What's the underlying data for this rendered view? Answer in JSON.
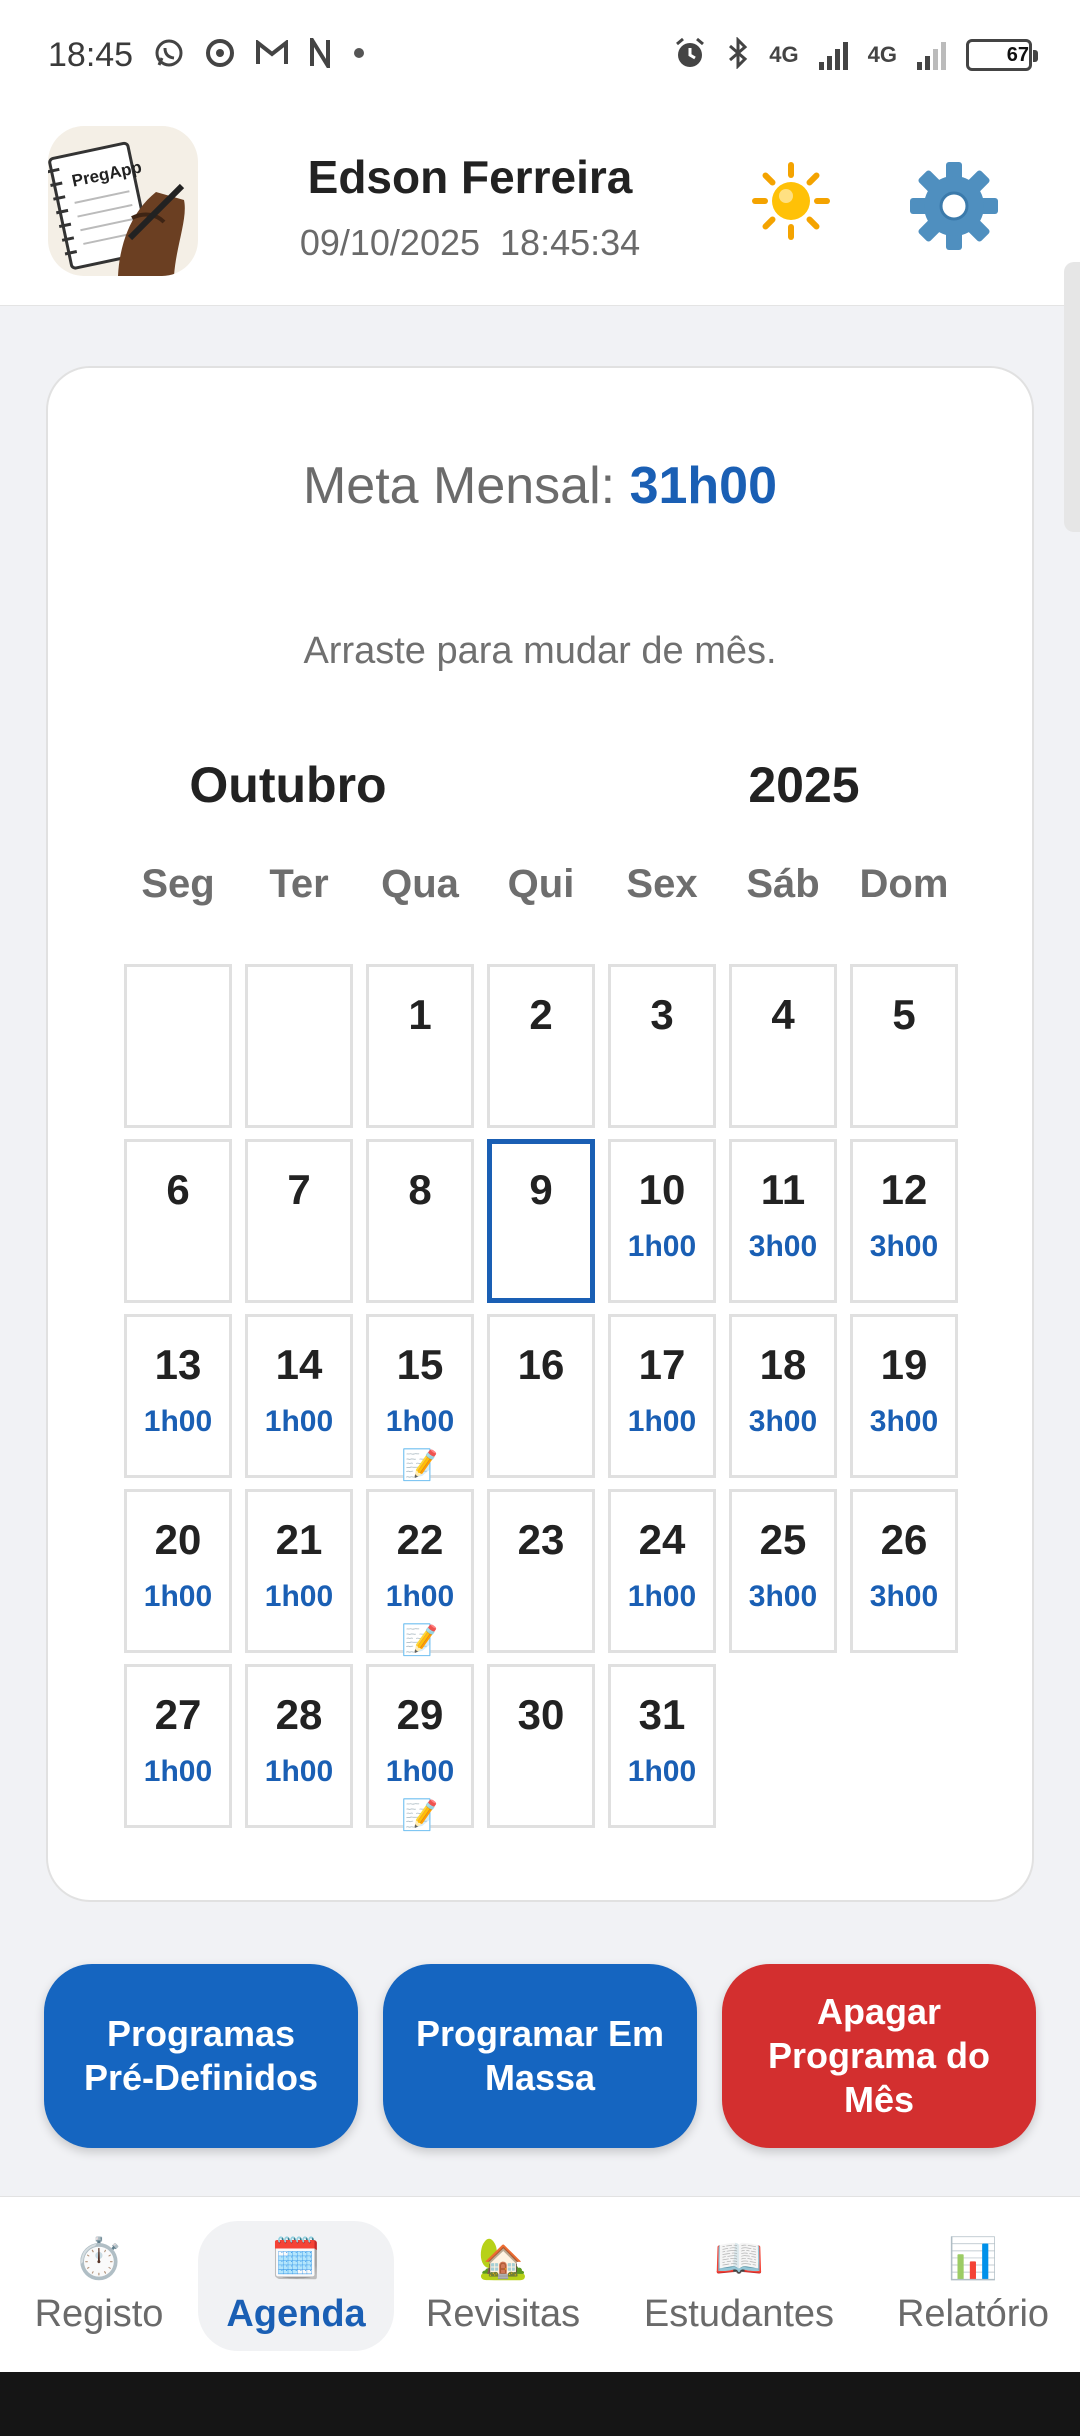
{
  "status_bar": {
    "time": "18:45",
    "battery": "67",
    "battery_level": 0.67,
    "network_1": "4G",
    "network_2": "4G",
    "notification_icons": [
      "whatsapp-icon",
      "chrome-icon",
      "gmail-icon",
      "n-app-icon",
      "dot-icon"
    ],
    "system_icons": [
      "alarm-icon",
      "bluetooth-icon",
      "signal-icon",
      "signal-icon",
      "battery-icon"
    ]
  },
  "header": {
    "logo_text": "PregApp",
    "user_name": "Edson Ferreira",
    "datetime": "09/10/2025  18:45:34",
    "theme_icon": "sun-icon",
    "settings_icon": "gear-icon"
  },
  "calendar": {
    "goal_label": "Meta Mensal:",
    "goal_value": "31h00",
    "hint": "Arraste para mudar de mês.",
    "month": "Outubro",
    "year": "2025",
    "weekdays": [
      "Seg",
      "Ter",
      "Qua",
      "Qui",
      "Sex",
      "Sáb",
      "Dom"
    ],
    "first_weekday_index": 2,
    "today": 9,
    "days": [
      {
        "d": "1",
        "h": "",
        "note": false
      },
      {
        "d": "2",
        "h": "",
        "note": false
      },
      {
        "d": "3",
        "h": "",
        "note": false
      },
      {
        "d": "4",
        "h": "",
        "note": false
      },
      {
        "d": "5",
        "h": "",
        "note": false
      },
      {
        "d": "6",
        "h": "",
        "note": false
      },
      {
        "d": "7",
        "h": "",
        "note": false
      },
      {
        "d": "8",
        "h": "",
        "note": false
      },
      {
        "d": "9",
        "h": "",
        "note": false
      },
      {
        "d": "10",
        "h": "1h00",
        "note": false
      },
      {
        "d": "11",
        "h": "3h00",
        "note": false
      },
      {
        "d": "12",
        "h": "3h00",
        "note": false
      },
      {
        "d": "13",
        "h": "1h00",
        "note": false
      },
      {
        "d": "14",
        "h": "1h00",
        "note": false
      },
      {
        "d": "15",
        "h": "1h00",
        "note": true
      },
      {
        "d": "16",
        "h": "",
        "note": false
      },
      {
        "d": "17",
        "h": "1h00",
        "note": false
      },
      {
        "d": "18",
        "h": "3h00",
        "note": false
      },
      {
        "d": "19",
        "h": "3h00",
        "note": false
      },
      {
        "d": "20",
        "h": "1h00",
        "note": false
      },
      {
        "d": "21",
        "h": "1h00",
        "note": false
      },
      {
        "d": "22",
        "h": "1h00",
        "note": true
      },
      {
        "d": "23",
        "h": "",
        "note": false
      },
      {
        "d": "24",
        "h": "1h00",
        "note": false
      },
      {
        "d": "25",
        "h": "3h00",
        "note": false
      },
      {
        "d": "26",
        "h": "3h00",
        "note": false
      },
      {
        "d": "27",
        "h": "1h00",
        "note": false
      },
      {
        "d": "28",
        "h": "1h00",
        "note": false
      },
      {
        "d": "29",
        "h": "1h00",
        "note": true
      },
      {
        "d": "30",
        "h": "",
        "note": false
      },
      {
        "d": "31",
        "h": "1h00",
        "note": false
      }
    ],
    "note_icon": "memo-icon"
  },
  "actions": {
    "predefined": "Programas Pré-Definidos",
    "bulk": "Programar Em Massa",
    "delete": "Apagar Programa do Mês"
  },
  "colors": {
    "primary": "#1565c0",
    "danger": "#d32f2f",
    "accent_text": "#1a5fb4"
  },
  "nav": {
    "active": "agenda",
    "items": [
      {
        "id": "registo",
        "label": "Registo",
        "icon": "stopwatch-icon",
        "glyph": "⏱️"
      },
      {
        "id": "agenda",
        "label": "Agenda",
        "icon": "calendar-icon",
        "glyph": "🗓️"
      },
      {
        "id": "revisitas",
        "label": "Revisitas",
        "icon": "house-icon",
        "glyph": "🏡"
      },
      {
        "id": "estudantes",
        "label": "Estudantes",
        "icon": "book-icon",
        "glyph": "📖"
      },
      {
        "id": "relatorio",
        "label": "Relatório",
        "icon": "bar-chart-icon",
        "glyph": "📊"
      }
    ]
  }
}
